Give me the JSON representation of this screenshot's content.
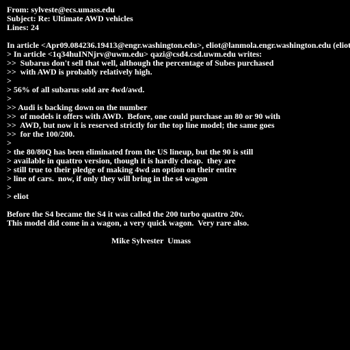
{
  "header": {
    "from": "From: sylveste@ecs.umass.edu",
    "subject": "Subject: Re: Ultimate AWD vehicles",
    "lines": "Lines: 24"
  },
  "body": {
    "attribution": "In article <Apr09.084236.19413@engr.washington.edu>, eliot@lanmola.engr.washington.edu (eliot) writes:",
    "q1": "> In article <1q34huINNjrv@uwm.edu> qazi@csd4.csd.uwm.edu writes:",
    "q2": ">>  Subarus don't sell that well, although the percentage of Subes purchased",
    "q3": ">>  with AWD is probably relatively high.",
    "q4": ">",
    "q5": "> 56% of all subarus sold are 4wd/awd.",
    "q6": ">",
    "q7": ">> Audi is backing down on the number",
    "q8": ">>  of models it offers with AWD.  Before, one could purchase an 80 or 90 with",
    "q9": ">>  AWD, but now it is reserved strictly for the top line model; the same goes",
    "q10": ">>  for the 100/200.",
    "q11": ">",
    "q12": "> the 80/80Q has been eliminated from the US lineup, but the 90 is still",
    "q13": "> available in quattro version, though it is hardly cheap.  they are",
    "q14": "> still true to their pledge of making 4wd an option on their entire",
    "q15": "> line of cars.  now, if only they will bring in the s4 wagon",
    "q16": ">",
    "q17": "> eliot",
    "reply1": "Before the S4 became the S4 it was called the 200 turbo quattro 20v.",
    "reply2": "This model did come in a wagon, a very quick wagon.  Very rare also.",
    "signature": "Mike Sylvester  Umass"
  }
}
